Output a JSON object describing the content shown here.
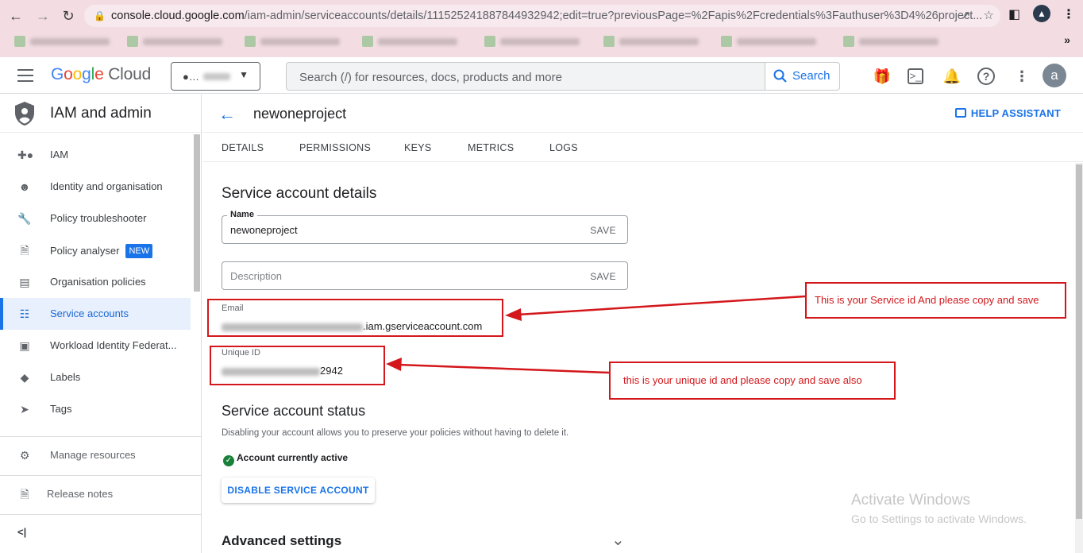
{
  "browser": {
    "url_host": "console.cloud.google.com",
    "url_path": "/iam-admin/serviceaccounts/details/111525241887844932942;edit=true?previousPage=%2Fapis%2Fcredentials%3Fauthuser%3D4%26project...",
    "avatar_letter": "a"
  },
  "header": {
    "logo": [
      "G",
      "o",
      "o",
      "g",
      "l",
      "e"
    ],
    "logo_suffix": "Cloud",
    "search_placeholder": "Search (/) for resources, docs, products and more",
    "search_button": "Search",
    "avatar": "a"
  },
  "sidebar": {
    "title": "IAM and admin",
    "items": [
      {
        "label": "IAM",
        "icon": "person-add-icon"
      },
      {
        "label": "Identity and organisation",
        "icon": "account-circle-icon"
      },
      {
        "label": "Policy troubleshooter",
        "icon": "wrench-icon"
      },
      {
        "label": "Policy analyser",
        "icon": "document-search-icon",
        "badge": "NEW"
      },
      {
        "label": "Organisation policies",
        "icon": "list-icon"
      },
      {
        "label": "Service accounts",
        "icon": "service-account-icon",
        "active": true
      },
      {
        "label": "Workload Identity Federat...",
        "icon": "id-card-icon"
      },
      {
        "label": "Labels",
        "icon": "label-icon"
      },
      {
        "label": "Tags",
        "icon": "tag-icon"
      }
    ],
    "manage_resources": "Manage resources",
    "release_notes": "Release notes",
    "collapse": "<|"
  },
  "page": {
    "title": "newoneproject",
    "help_assistant": "HELP ASSISTANT",
    "tabs": [
      "DETAILS",
      "PERMISSIONS",
      "KEYS",
      "METRICS",
      "LOGS"
    ]
  },
  "details": {
    "section_title": "Service account details",
    "name_label": "Name",
    "name_value": "newoneproject",
    "save_label": "SAVE",
    "description_placeholder": "Description",
    "email_label": "Email",
    "email_suffix": ".iam.gserviceaccount.com",
    "unique_id_label": "Unique ID",
    "unique_id_suffix": "2942"
  },
  "status": {
    "section_title": "Service account status",
    "description": "Disabling your account allows you to preserve your policies without having to delete it.",
    "active_text": "Account currently active",
    "disable_button": "DISABLE SERVICE ACCOUNT"
  },
  "advanced": {
    "title": "Advanced settings"
  },
  "watermark": {
    "line1": "Activate Windows",
    "line2": "Go to Settings to activate Windows."
  },
  "annotations": {
    "service_id_note": "This is your Service id And please copy and save",
    "unique_id_note": "this is your unique id and please copy and save also"
  },
  "colors": {
    "accent": "#1a73e8",
    "annotation_red": "#d3171b",
    "browser_tint": "#f3dde3"
  }
}
